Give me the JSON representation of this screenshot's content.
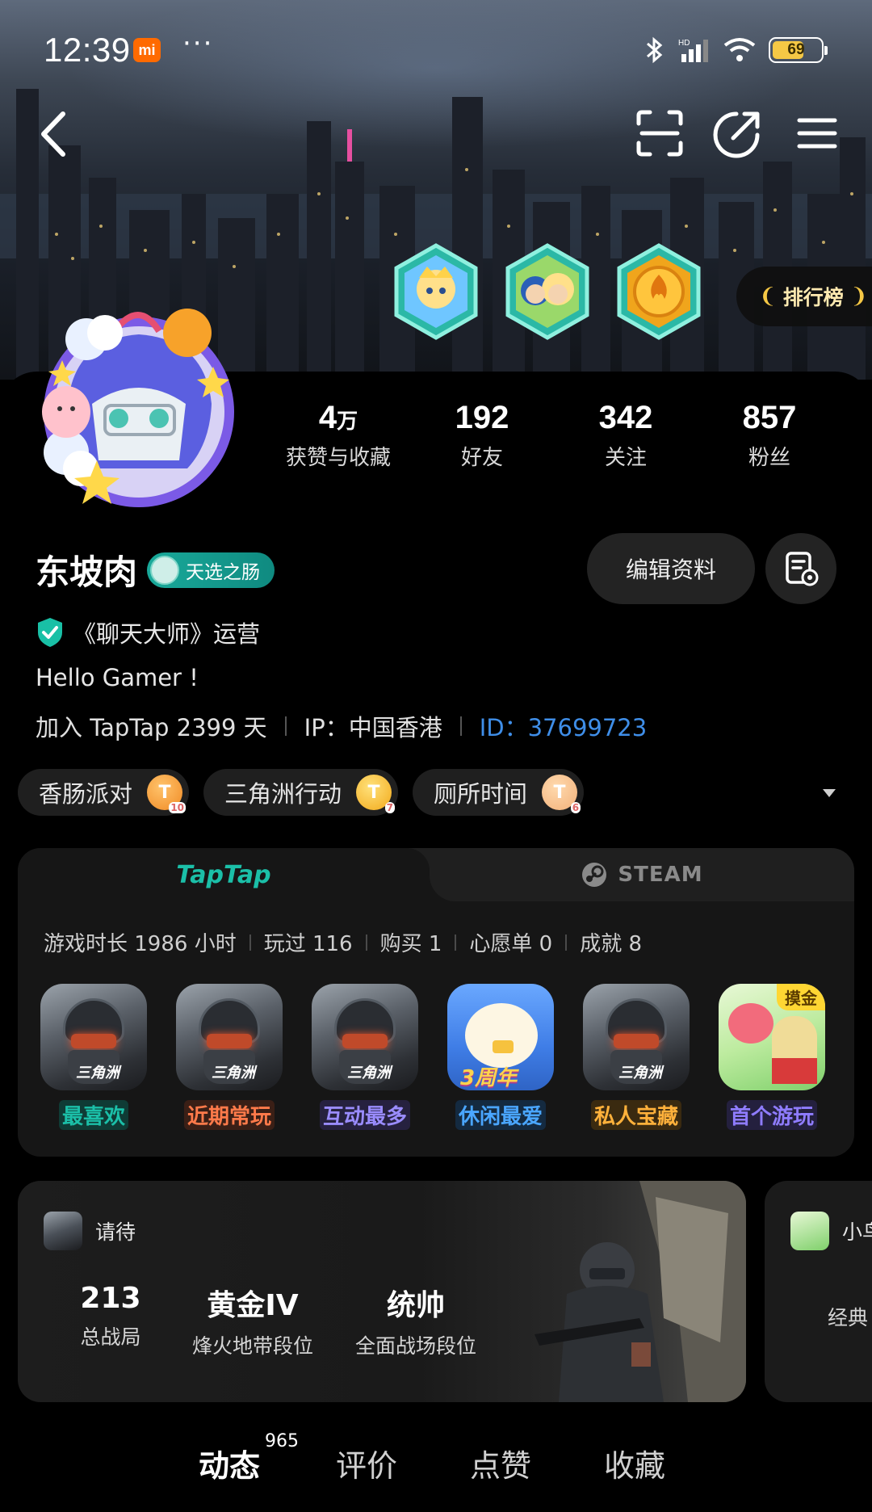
{
  "status_bar": {
    "time": "12:39",
    "carrier_badge": "mi",
    "more": "···",
    "battery": "69",
    "battery_level_percent": 69
  },
  "nav": {
    "back_icon": "chevron-left-icon",
    "scan_icon": "scan-icon",
    "share_icon": "share-icon",
    "menu_icon": "menu-icon"
  },
  "ranking": {
    "label": "排行榜"
  },
  "stats": [
    {
      "num": "4",
      "unit": "万",
      "label": "获赞与收藏"
    },
    {
      "num": "192",
      "unit": "",
      "label": "好友"
    },
    {
      "num": "342",
      "unit": "",
      "label": "关注"
    },
    {
      "num": "857",
      "unit": "",
      "label": "粉丝"
    }
  ],
  "profile": {
    "name": "东坡肉",
    "title_tag": "天选之肠",
    "edit_label": "编辑资料",
    "verify_text": "《聊天大师》运营",
    "bio": "Hello Gamer !",
    "joined": "加入 TapTap 2399 天",
    "ip": "IP：中国香港",
    "id": "ID：37699723"
  },
  "game_tags": [
    {
      "name": "香肠派对",
      "medal": "T",
      "level": "10"
    },
    {
      "name": "三角洲行动",
      "medal": "T",
      "level": "7"
    },
    {
      "name": "厕所时间",
      "medal": "T",
      "level": "6"
    }
  ],
  "game_card": {
    "tab_taptap": "TapTap",
    "tab_steam": "STEAM",
    "summary": [
      "游戏时长 1986 小时",
      "玩过 116",
      "购买 1",
      "心愿单 0",
      "成就 8"
    ],
    "games": [
      {
        "label": "最喜欢",
        "color": "#1bbfa8",
        "bg": "#0f3b35",
        "art": "soldier"
      },
      {
        "label": "近期常玩",
        "color": "#ff7a4a",
        "bg": "#3a1f16",
        "art": "soldier"
      },
      {
        "label": "互动最多",
        "color": "#9a8cff",
        "bg": "#26213f",
        "art": "soldier"
      },
      {
        "label": "休闲最爱",
        "color": "#4aa6ff",
        "bg": "#142a40",
        "art": "egg",
        "art_text": "3周年"
      },
      {
        "label": "私人宝藏",
        "color": "#ffb13b",
        "bg": "#3a2a10",
        "art": "soldier"
      },
      {
        "label": "首个游玩",
        "color": "#8f7cff",
        "bg": "#24203e",
        "art": "party",
        "art_text": "摸金"
      }
    ],
    "soldier_logo": "三角洲"
  },
  "stat_card": {
    "game_name": "请待",
    "items": [
      {
        "value": "213",
        "key": "总战局"
      },
      {
        "value": "黄金IV",
        "key": "烽火地带段位"
      },
      {
        "value": "统帅",
        "key": "全面战场段位"
      }
    ]
  },
  "stat_card2": {
    "game_name": "小鸟",
    "key": "经典"
  },
  "bottom_tabs": [
    {
      "label": "动态",
      "count": "965"
    },
    {
      "label": "评价"
    },
    {
      "label": "点赞"
    },
    {
      "label": "收藏"
    }
  ],
  "colors": {
    "accent": "#17c0a6",
    "id_link": "#3f8ee8"
  }
}
